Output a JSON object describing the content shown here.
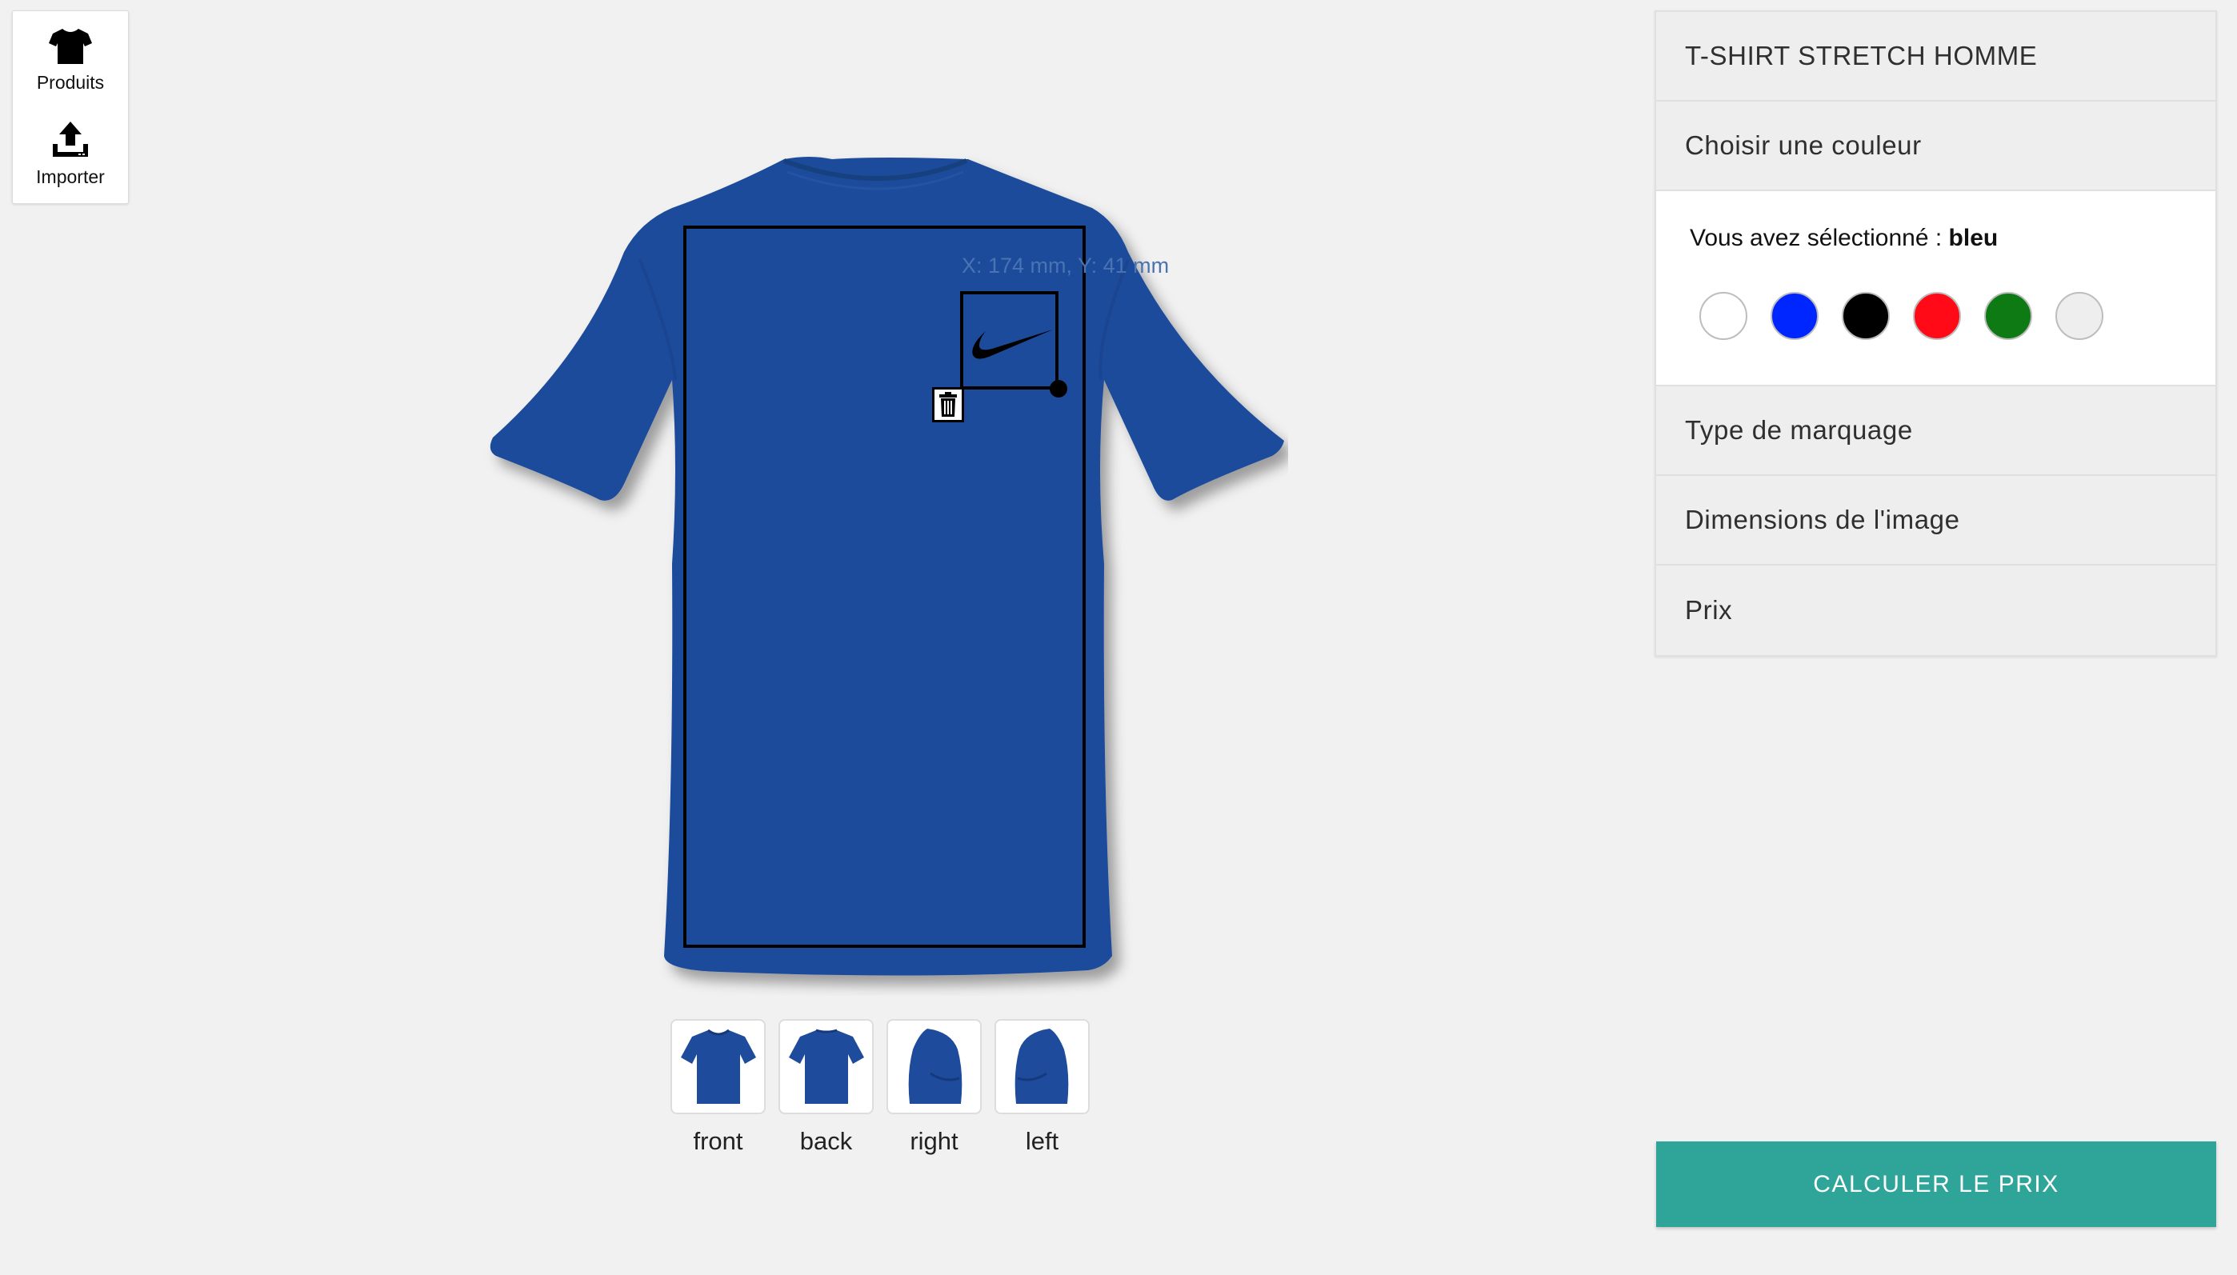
{
  "toolbar": {
    "items": [
      {
        "label": "Produits",
        "icon": "tshirt-icon"
      },
      {
        "label": "Importer",
        "icon": "upload-icon"
      }
    ]
  },
  "canvas": {
    "shirt_color": "#1d4a99",
    "logo_position_label": "X: 174 mm, Y: 41 mm",
    "logo": "swoosh-icon"
  },
  "views": [
    {
      "label": "front"
    },
    {
      "label": "back"
    },
    {
      "label": "right"
    },
    {
      "label": "left"
    }
  ],
  "panel": {
    "product_title": "T-SHIRT STRETCH HOMME",
    "color_heading": "Choisir une couleur",
    "selected_prefix": "Vous avez sélectionné :",
    "selected_color": "bleu",
    "swatches": [
      {
        "name": "white",
        "hex": "#ffffff"
      },
      {
        "name": "blue",
        "hex": "#0026ff"
      },
      {
        "name": "black",
        "hex": "#000000"
      },
      {
        "name": "red",
        "hex": "#ff0a16"
      },
      {
        "name": "green",
        "hex": "#0e7a14"
      },
      {
        "name": "light-grey",
        "hex": "#eeeeee"
      }
    ],
    "marking_type": "Type de marquage",
    "image_dimensions": "Dimensions de l'image",
    "price": "Prix"
  },
  "calculate_button": "CALCULER LE PRIX",
  "colors": {
    "accent": "#2fa59a",
    "background": "#f1f1f1"
  }
}
